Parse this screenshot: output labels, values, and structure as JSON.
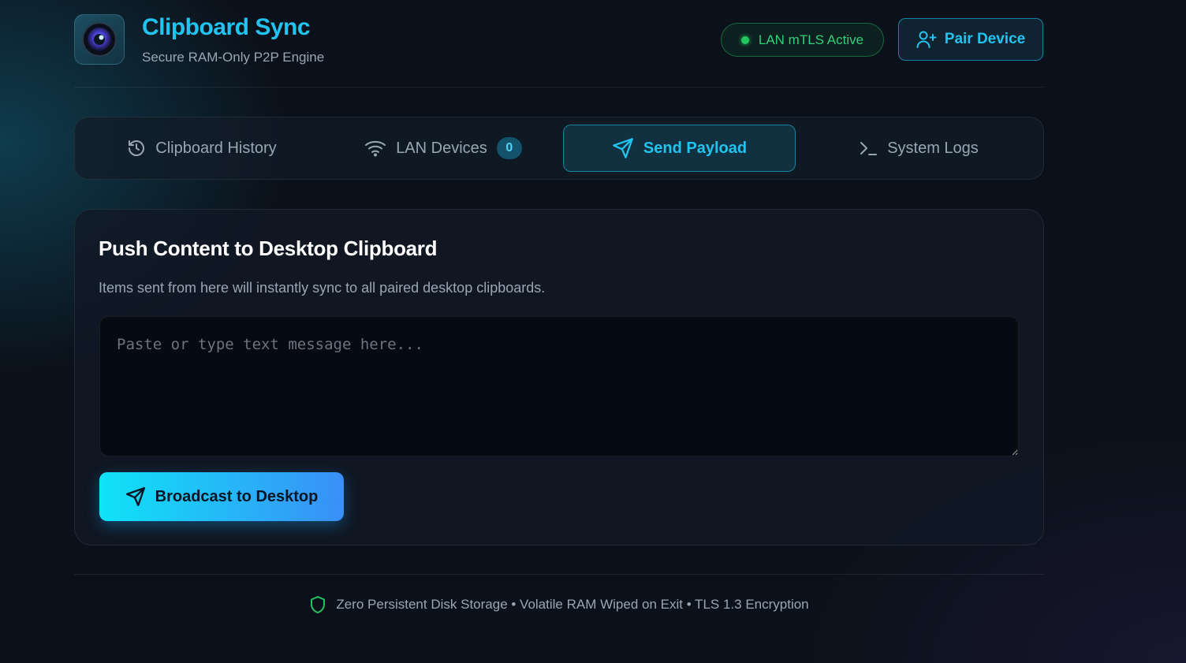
{
  "app": {
    "title": "Clipboard Sync",
    "subtitle": "Secure RAM-Only P2P Engine",
    "logo_icon": "lens-logo-icon"
  },
  "header": {
    "status_label": "LAN mTLS Active",
    "status_color": "#22c55e",
    "pair_button_label": "Pair Device",
    "pair_icon": "user-plus-icon"
  },
  "tabs": [
    {
      "label": "Clipboard History",
      "icon": "history-icon",
      "active": false
    },
    {
      "label": "LAN Devices",
      "icon": "wifi-icon",
      "badge": "0",
      "active": false
    },
    {
      "label": "Send Payload",
      "icon": "send-icon",
      "active": true
    },
    {
      "label": "System Logs",
      "icon": "terminal-icon",
      "active": false
    }
  ],
  "send_panel": {
    "title": "Push Content to Desktop Clipboard",
    "description": "Items sent from here will instantly sync to all paired desktop clipboards.",
    "input_value": "",
    "input_placeholder": "Paste or type text message here...",
    "broadcast_label": "Broadcast to Desktop"
  },
  "footer": {
    "text": "Zero Persistent Disk Storage • Volatile RAM Wiped on Exit • TLS 1.3 Encryption",
    "icon": "shield-icon"
  },
  "colors": {
    "accent": "#22c3ef",
    "success": "#22c55e",
    "background": "#0b111a"
  }
}
